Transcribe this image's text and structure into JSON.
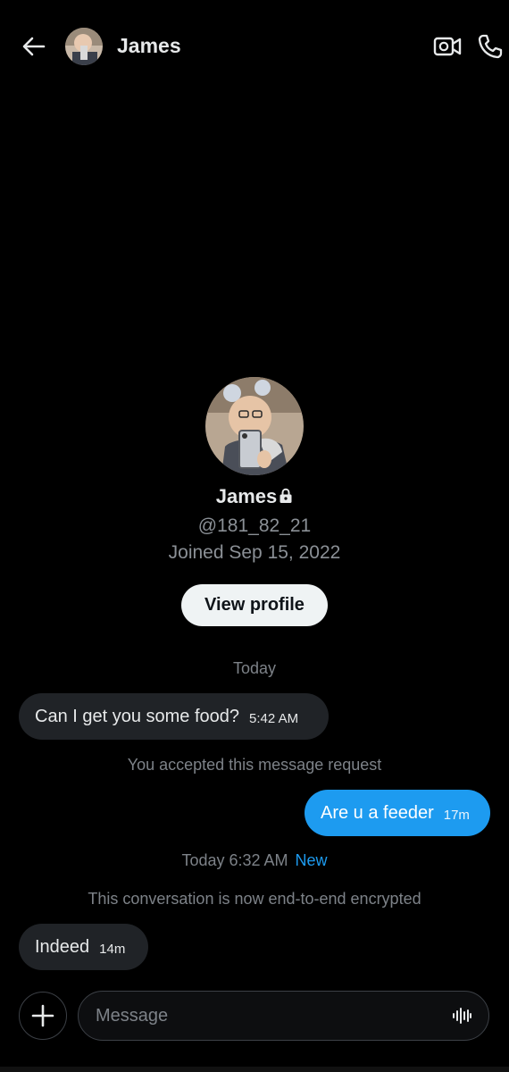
{
  "header": {
    "name": "James",
    "back_icon": "arrow-left-icon",
    "video_icon": "video-call-icon",
    "call_icon": "phone-icon"
  },
  "profile": {
    "name": "James",
    "lock_icon": "lock-icon",
    "handle": "@181_82_21",
    "joined": "Joined Sep 15, 2022",
    "view_profile_label": "View profile"
  },
  "conversation": {
    "date_label": "Today",
    "messages": [
      {
        "direction": "incoming",
        "text": "Can I get you some food?",
        "time": "5:42 AM"
      },
      {
        "direction": "outgoing",
        "text": "Are u a feeder",
        "time": "17m"
      },
      {
        "direction": "incoming",
        "text": "Indeed",
        "time": "14m"
      }
    ],
    "accepted_note": "You accepted this message request",
    "divider_time": "Today 6:32 AM",
    "new_label": "New",
    "encrypted_note": "This conversation is now end-to-end encrypted"
  },
  "composer": {
    "placeholder": "Message",
    "add_icon": "plus-icon",
    "voice_icon": "voice-wave-icon"
  },
  "colors": {
    "background": "#000000",
    "accent": "#1d9bf0",
    "incoming_bubble": "#202327",
    "muted_text": "#7d8288"
  }
}
